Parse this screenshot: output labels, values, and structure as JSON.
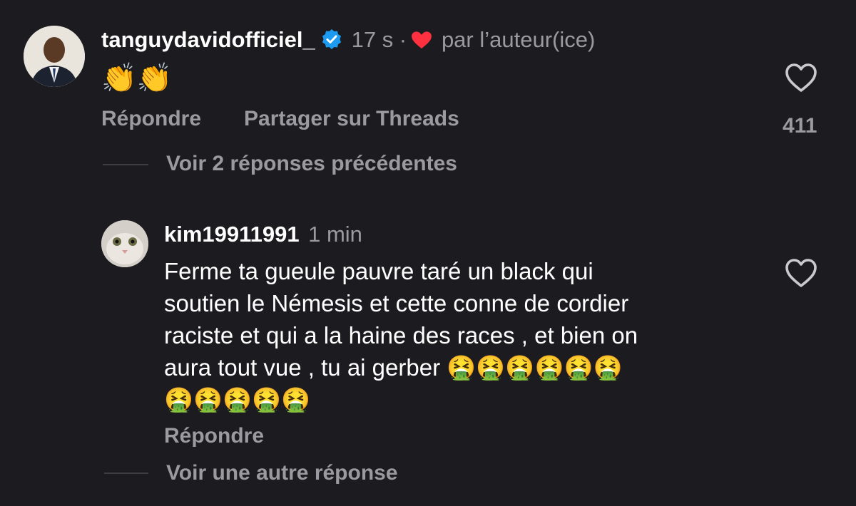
{
  "comment": {
    "username": "tanguydavidofficiel_",
    "time": "17 s",
    "separator": "·",
    "author_like_label": "par l’auteur(ice)",
    "body": "👏👏",
    "reply_label": "Répondre",
    "share_label": "Partager sur Threads",
    "like_count": "411",
    "view_replies_label": "Voir 2 réponses précédentes",
    "icons": {
      "verified": "verified-badge-icon",
      "author_heart": "heart-filled-icon",
      "like": "heart-outline-icon"
    },
    "colors": {
      "verified": "#1d9bf0",
      "author_heart": "#ff3040"
    }
  },
  "reply": {
    "username": "kim19911991",
    "time": "1 min",
    "body_lines": [
      "Ferme ta gueule pauvre taré un black qui",
      "soutien le Némesis et cette conne de cordier",
      "raciste  et qui a la haine des races , et bien on",
      "aura tout vue , tu ai gerber 🤮🤮🤮🤮🤮🤮",
      "🤮🤮🤮🤮🤮"
    ],
    "reply_label": "Répondre",
    "view_other_label": "Voir une autre réponse",
    "icons": {
      "like": "heart-outline-icon"
    }
  },
  "colors": {
    "background": "#1c1c20",
    "text": "#ffffff",
    "muted": "#9a9aa0",
    "line": "#3e3e44"
  }
}
